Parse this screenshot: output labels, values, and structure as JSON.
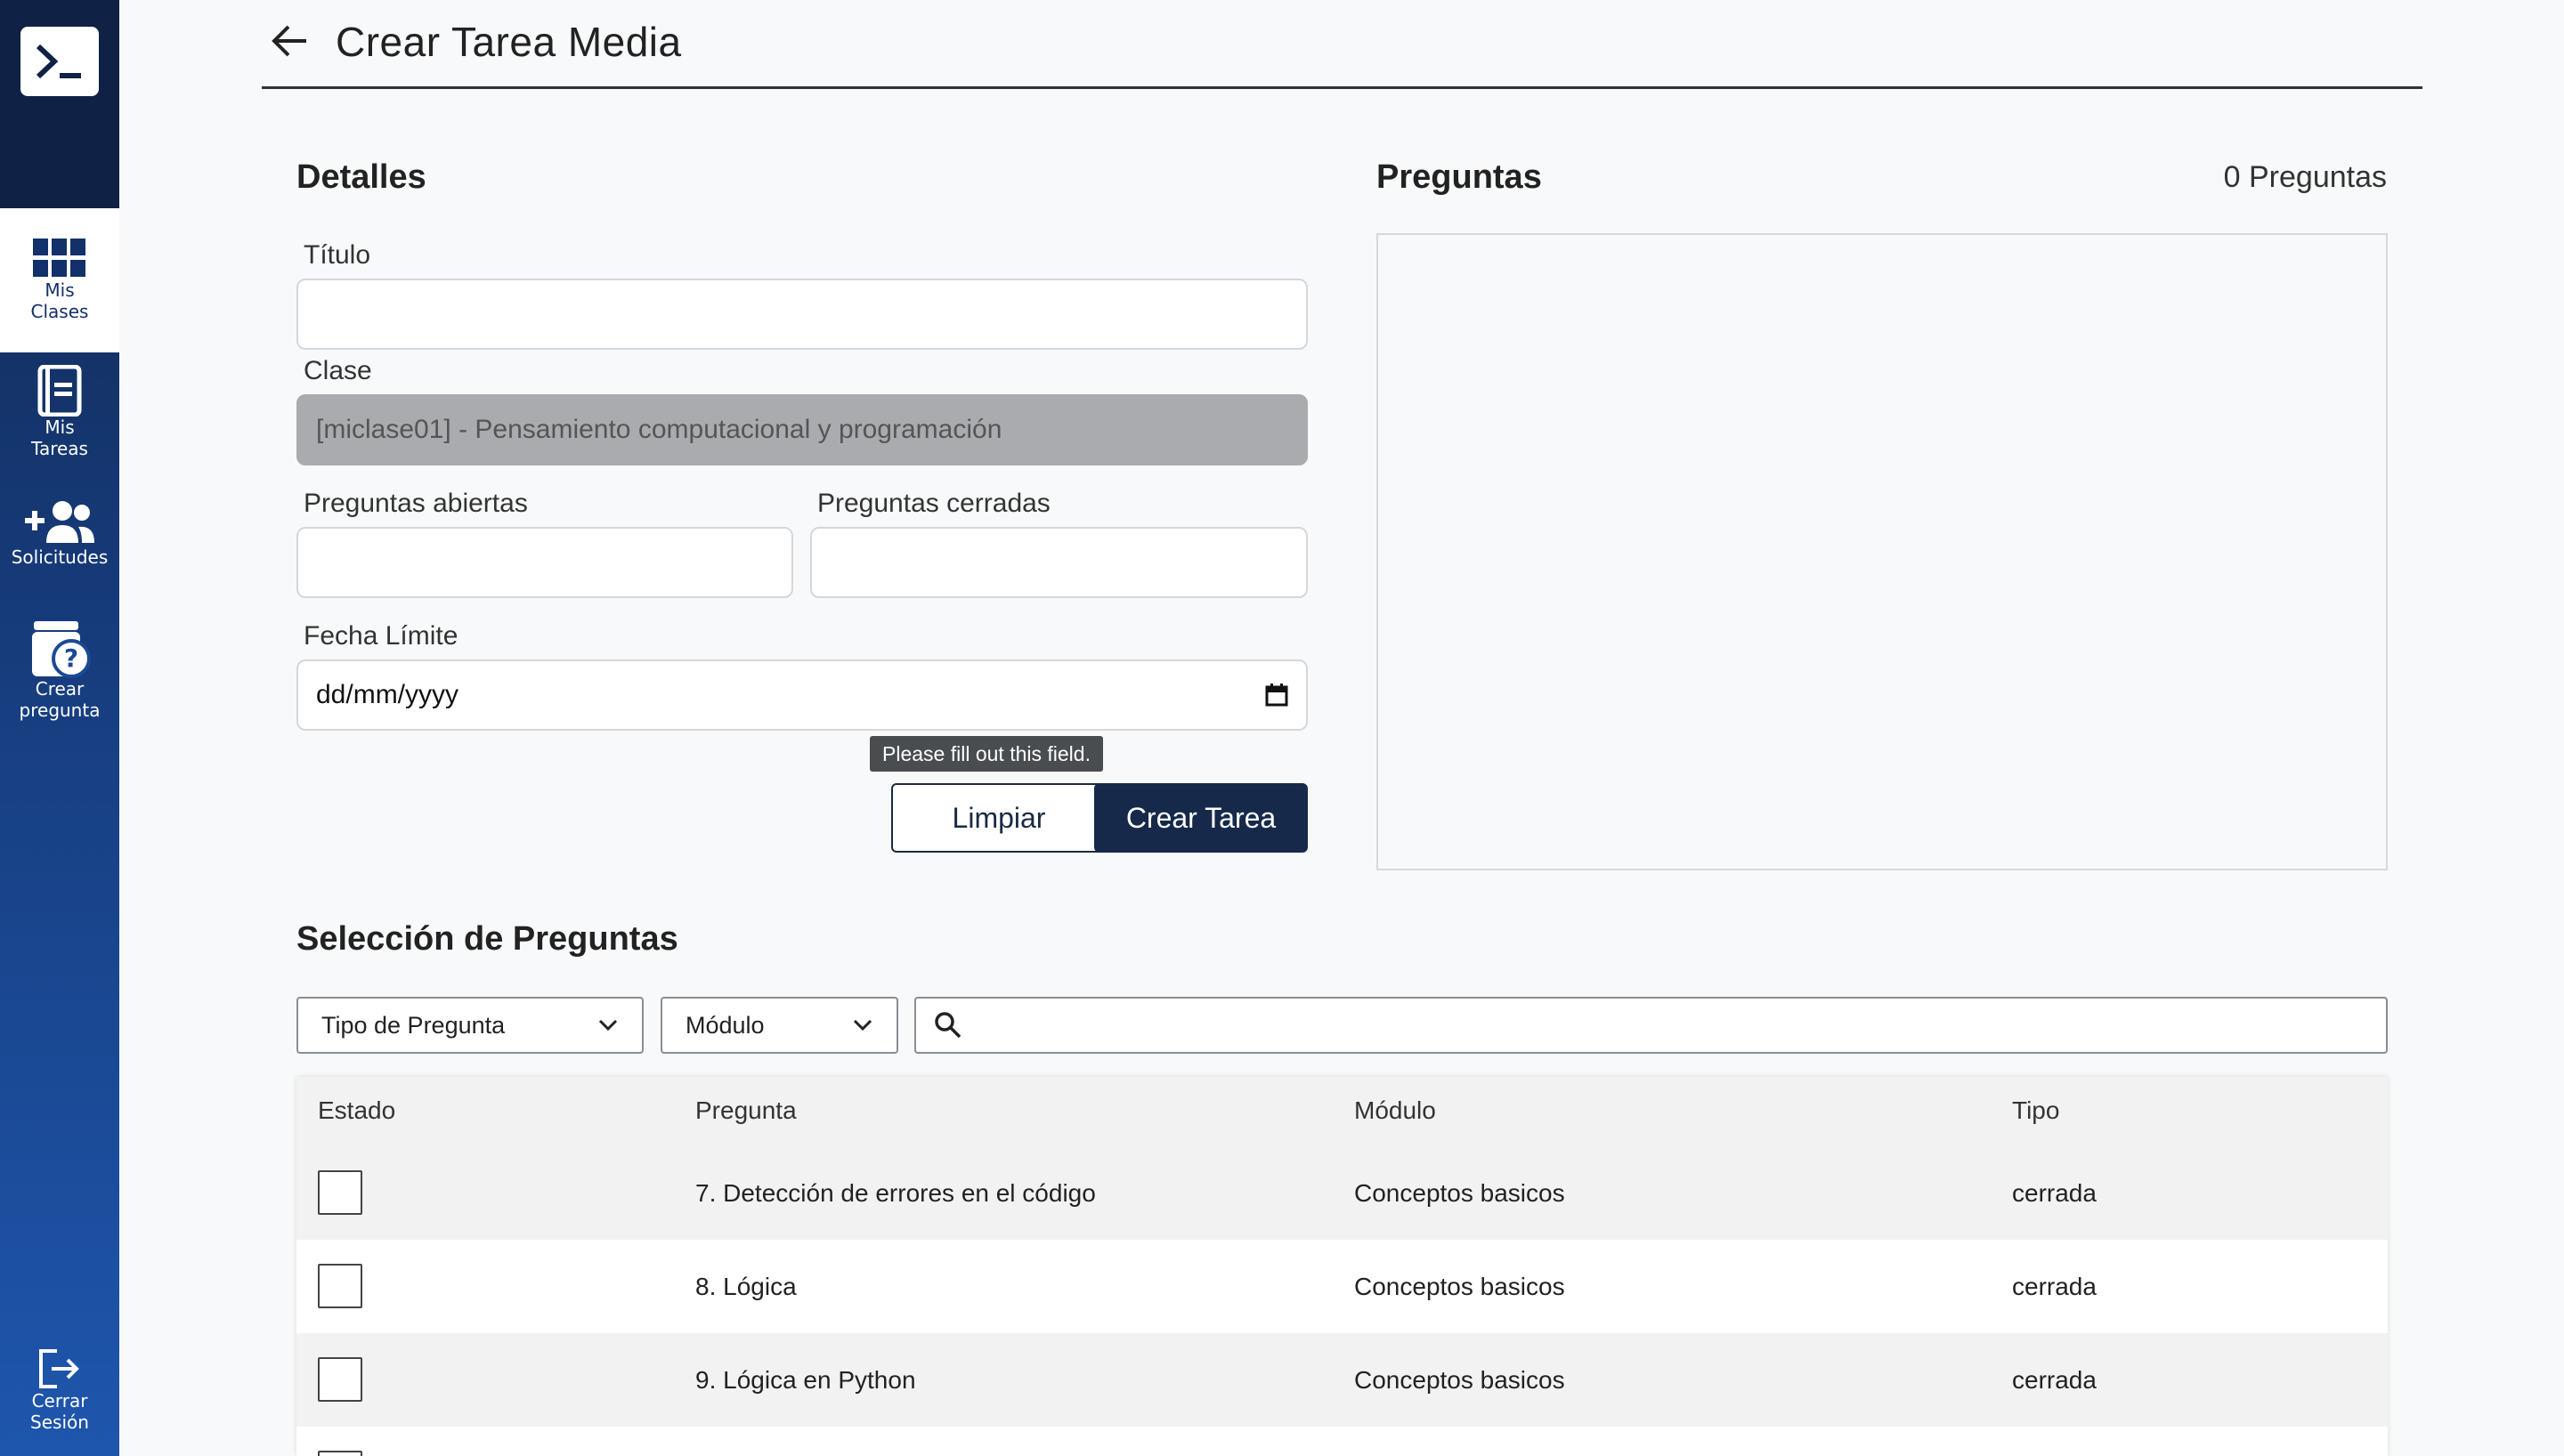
{
  "sidebar": {
    "items": [
      {
        "label_line1": "Mis",
        "label_line2": "Clases",
        "icon": "grid-icon"
      },
      {
        "label_line1": "Mis",
        "label_line2": "Tareas",
        "icon": "notebook-icon"
      },
      {
        "label_line1": "Solicitudes",
        "label_line2": "",
        "icon": "add-users-icon"
      },
      {
        "label_line1": "Crear",
        "label_line2": "pregunta",
        "icon": "question-box-icon"
      }
    ],
    "logout": {
      "label_line1": "Cerrar",
      "label_line2": "Sesión",
      "icon": "logout-icon"
    }
  },
  "header": {
    "title": "Crear Tarea Media"
  },
  "details": {
    "title": "Detalles",
    "titulo_label": "Título",
    "titulo_value": "",
    "clase_label": "Clase",
    "clase_value": "[miclase01] - Pensamiento computacional y programación",
    "abiertas_label": "Preguntas abiertas",
    "cerradas_label": "Preguntas cerradas",
    "fecha_label": "Fecha Límite",
    "fecha_placeholder": "dd/mm/yyyy",
    "tooltip": "Please fill out this field.",
    "limpiar_label": "Limpiar",
    "crear_label": "Crear Tarea"
  },
  "preguntas": {
    "title": "Preguntas",
    "count_text": "0 Preguntas"
  },
  "seleccion": {
    "title": "Selección de Preguntas",
    "tipo_select": "Tipo de Pregunta",
    "modulo_select": "Módulo",
    "search_value": ""
  },
  "table": {
    "headers": [
      "Estado",
      "Pregunta",
      "Módulo",
      "Tipo"
    ],
    "rows": [
      {
        "pregunta": "7. Detección de errores en el código",
        "modulo": "Conceptos basicos",
        "tipo": "cerrada",
        "checked": false
      },
      {
        "pregunta": "8. Lógica",
        "modulo": "Conceptos basicos",
        "tipo": "cerrada",
        "checked": false
      },
      {
        "pregunta": "9. Lógica en Python",
        "modulo": "Conceptos basicos",
        "tipo": "cerrada",
        "checked": false
      }
    ]
  },
  "colors": {
    "sidebar_top": "#10284e",
    "sidebar_bottom": "#1e56ad",
    "primary_button": "#16294a",
    "disabled_input": "#a9abae"
  }
}
